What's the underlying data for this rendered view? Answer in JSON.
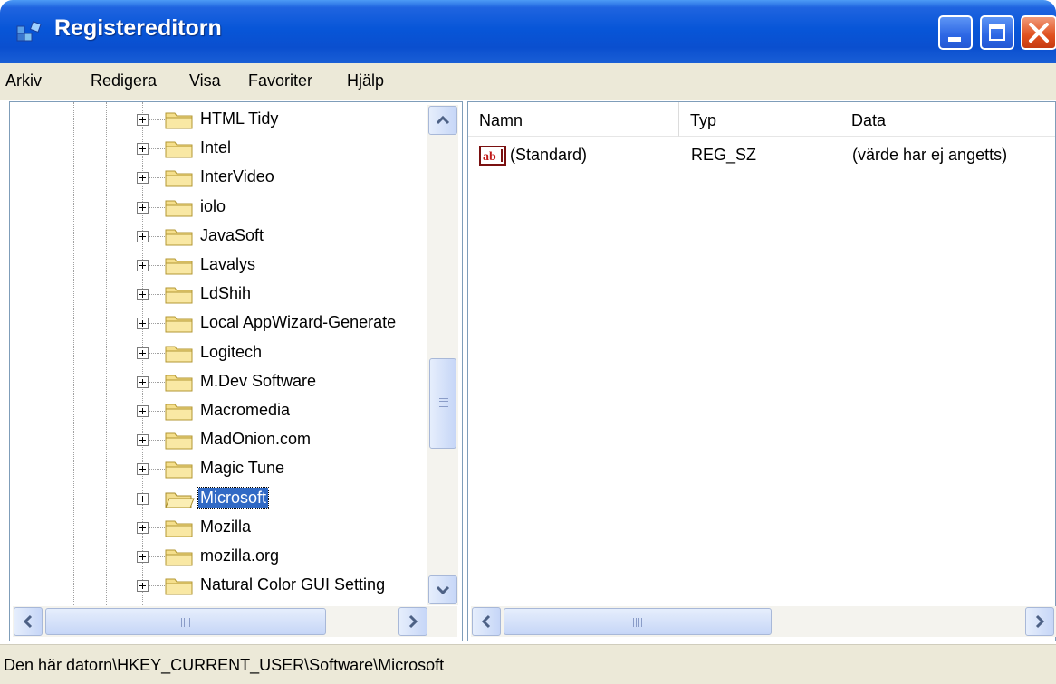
{
  "window": {
    "title": "Registereditorn",
    "icon": "regedit-icon"
  },
  "menu": [
    "Arkiv",
    "Redigera",
    "Visa",
    "Favoriter",
    "Hjälp"
  ],
  "tree": {
    "items": [
      {
        "label": "HTML Tidy"
      },
      {
        "label": "Intel"
      },
      {
        "label": "InterVideo"
      },
      {
        "label": "iolo"
      },
      {
        "label": "JavaSoft"
      },
      {
        "label": "Lavalys"
      },
      {
        "label": "LdShih"
      },
      {
        "label": "Local AppWizard-Generate"
      },
      {
        "label": "Logitech"
      },
      {
        "label": "M.Dev Software"
      },
      {
        "label": "Macromedia"
      },
      {
        "label": "MadOnion.com"
      },
      {
        "label": "Magic Tune"
      },
      {
        "label": "Microsoft",
        "selected": true
      },
      {
        "label": "Mozilla"
      },
      {
        "label": "mozilla.org"
      },
      {
        "label": "Natural Color GUI Setting"
      }
    ]
  },
  "list": {
    "columns": [
      "Namn",
      "Typ",
      "Data"
    ],
    "rows": [
      {
        "name": "(Standard)",
        "type": "REG_SZ",
        "data": "(värde har ej angetts)",
        "icon": "string-value-icon"
      }
    ]
  },
  "status": {
    "path": "Den här datorn\\HKEY_CURRENT_USER\\Software\\Microsoft"
  },
  "colors": {
    "titlebar": "#0a4fcf",
    "selection": "#316ac5",
    "chrome": "#ece9d8",
    "close": "#e0501e"
  }
}
